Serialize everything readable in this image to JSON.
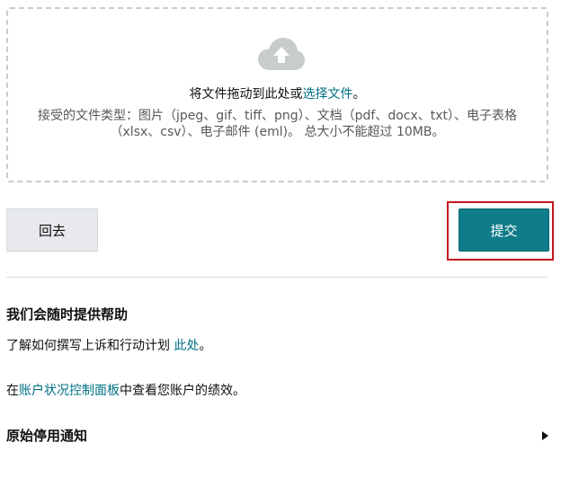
{
  "dropzone": {
    "main_text": "将文件拖动到此处或",
    "select_link": "选择文件",
    "main_suffix": "。",
    "sub_text": "接受的文件类型：图片（jpeg、gif、tiff、png）、文档（pdf、docx、txt）、电子表格（xlsx、csv）、电子邮件 (eml)。 总大小不能超过 10MB。",
    "icon": "cloud-upload-icon"
  },
  "actions": {
    "back_label": "回去",
    "submit_label": "提交",
    "submit_color": "#0f7c8a",
    "highlight_color": "#c7161d"
  },
  "help": {
    "title": "我们会随时提供帮助",
    "line1_prefix": "了解如何撰写上诉和行动计划 ",
    "line1_link": "此处",
    "line1_suffix": "。",
    "line2_prefix": "在",
    "line2_link": "账户状况控制面板",
    "line2_suffix": "中查看您账户的绩效。"
  },
  "notice": {
    "label": "原始停用通知",
    "icon": "caret-right-icon"
  }
}
